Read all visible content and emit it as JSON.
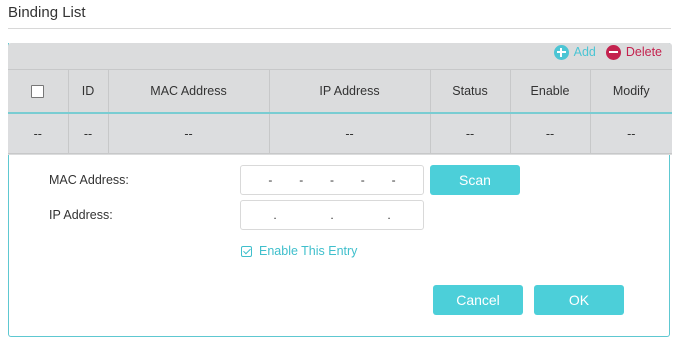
{
  "section_title": "Binding List",
  "toolbar": {
    "add_label": "Add",
    "delete_label": "Delete",
    "add_color": "#4cc5d4",
    "delete_color": "#c4234f"
  },
  "table": {
    "headers": [
      "",
      "ID",
      "MAC Address",
      "IP Address",
      "Status",
      "Enable",
      "Modify"
    ],
    "rows": [
      [
        "--",
        "--",
        "--",
        "--",
        "--",
        "--",
        "--"
      ]
    ]
  },
  "form": {
    "mac_label": "MAC Address:",
    "ip_label": "IP Address:",
    "mac_separators": [
      "-",
      "-",
      "-",
      "-",
      "-"
    ],
    "ip_separators": [
      ".",
      ".",
      "."
    ],
    "scan_label": "Scan",
    "enable_label": "Enable This Entry",
    "enable_checked": true,
    "cancel_label": "Cancel",
    "ok_label": "OK"
  },
  "colors": {
    "accent": "#4ccfd9",
    "panel_bg": "#dbdcdd"
  }
}
